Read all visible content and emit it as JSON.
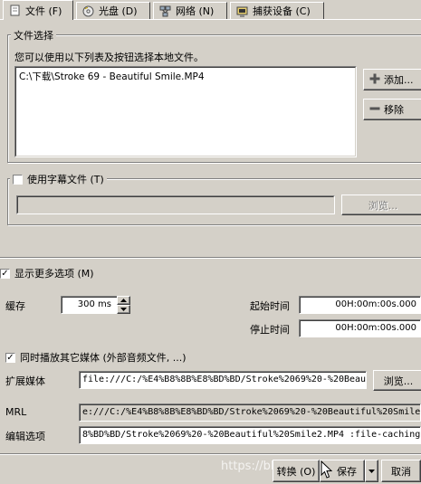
{
  "tabs": [
    {
      "label": "文件 (F)",
      "icon": "file-icon",
      "active": true
    },
    {
      "label": "光盘 (D)",
      "icon": "disc-icon"
    },
    {
      "label": "网络 (N)",
      "icon": "network-icon"
    },
    {
      "label": "捕获设备 (C)",
      "icon": "capture-device-icon"
    }
  ],
  "file_selection": {
    "legend": "文件选择",
    "hint": "您可以使用以下列表及按钮选择本地文件。",
    "files": [
      "C:\\下载\\Stroke 69 - Beautiful Smile.MP4"
    ],
    "add_label": "添加...",
    "remove_label": "移除"
  },
  "subtitle": {
    "label": "使用字幕文件 (T)",
    "browse_label": "浏览..."
  },
  "more_options": {
    "label": "显示更多选项 (M)",
    "checked": true
  },
  "cache": {
    "label": "缓存",
    "value": "300 ms"
  },
  "start_time": {
    "label": "起始时间",
    "value": "00H:00m:00s.000"
  },
  "stop_time": {
    "label": "停止时间",
    "value": "00H:00m:00s.000"
  },
  "sync_play": {
    "label": "同时播放其它媒体 (外部音频文件, ...)",
    "checked": true
  },
  "extra_media": {
    "label": "扩展媒体",
    "value": "file:///C:/%E4%B8%8B%E8%BD%BD/Stroke%2069%20-%20Beau",
    "browse_label": "浏览..."
  },
  "mrl": {
    "label": "MRL",
    "value": "e:///C:/%E4%B8%8B%E8%BD%BD/Stroke%2069%20-%20Beautiful%20Smile."
  },
  "edit_options": {
    "label": "编辑选项",
    "value": "8%BD%BD/Stroke%2069%20-%20Beautiful%20Smile2.MP4 :file-caching="
  },
  "footer": {
    "convert_label": "转换 (O)",
    "save_label": "保存",
    "cancel_label": "取消",
    "watermark": "https://blog.csdn.net/..."
  },
  "colors": {
    "face": "#d4d0c8",
    "shadow": "#808080",
    "highlight": "#ffffff"
  }
}
